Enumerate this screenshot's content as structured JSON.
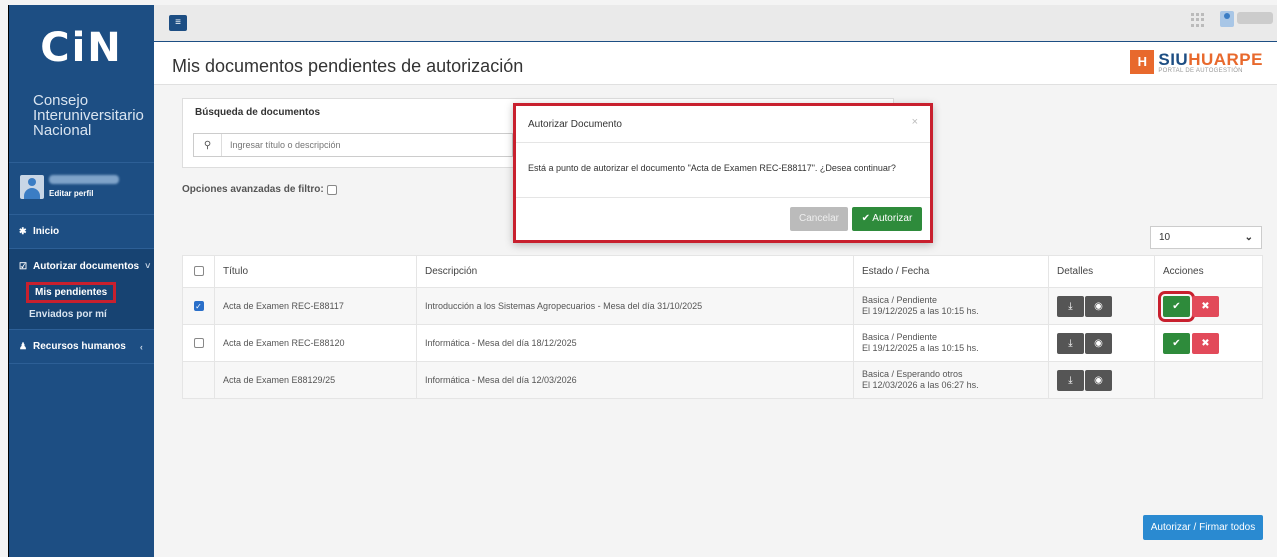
{
  "sidebar": {
    "logo": "CiN",
    "org_line1": "Consejo",
    "org_line2": "Interuniversitario",
    "org_line3": "Nacional",
    "edit_profile": "Editar perfil",
    "nav": {
      "home": {
        "icon": "home-icon",
        "label": "Inicio"
      },
      "authorize": {
        "icon": "check-square-icon",
        "label": "Autorizar documentos"
      },
      "pending": {
        "label": "Mis pendientes"
      },
      "sent": {
        "label": "Enviados por mí"
      },
      "hr": {
        "icon": "user-icon",
        "label": "Recursos humanos"
      }
    }
  },
  "header": {
    "title": "Mis documentos pendientes de autorización",
    "brand": {
      "name_a": "SIU",
      "name_b": "HUARPE",
      "subtitle": "PORTAL DE AUTOGESTIÓN"
    }
  },
  "search": {
    "title": "Búsqueda de documentos",
    "placeholder": "Ingresar título o descripción"
  },
  "filters": {
    "advanced_label": "Opciones avanzadas de filtro:"
  },
  "pagesize": {
    "value": "10"
  },
  "table": {
    "columns": [
      "Título",
      "Descripción",
      "Estado / Fecha",
      "Detalles",
      "Acciones"
    ],
    "rows": [
      {
        "checked": true,
        "title": "Acta de Examen REC-E88117",
        "description": "Introducción a los Sistemas Agropecuarios - Mesa del día 31/10/2025",
        "state": "Basica / Pendiente",
        "date": "El 19/12/2025 a las 10:15 hs."
      },
      {
        "checked": false,
        "title": "Acta de Examen REC-E88120",
        "description": "Informática - Mesa del día 18/12/2025",
        "state": "Basica / Pendiente",
        "date": "El 19/12/2025 a las 10:15 hs."
      },
      {
        "checked": null,
        "title": "Acta de Examen E88129/25",
        "description": "Informática - Mesa del día 12/03/2026",
        "state": "Basica / Esperando otros",
        "date": "El 12/03/2026 a las 06:27 hs."
      }
    ]
  },
  "bulk_action": {
    "label": "Autorizar / Firmar todos"
  },
  "modal": {
    "title": "Autorizar Documento",
    "close": "×",
    "message": "Está a punto de autorizar el documento \"Acta de Examen REC-E88117\". ¿Desea continuar?",
    "cancel": "Cancelar",
    "confirm": "Autorizar"
  },
  "colors": {
    "sidebar": "#1d4e83",
    "accent_green": "#2e8b3b",
    "accent_red": "#e24a5a",
    "highlight": "#c8202e",
    "primary_blue": "#2a8ad1",
    "brand_orange": "#e8692d"
  }
}
